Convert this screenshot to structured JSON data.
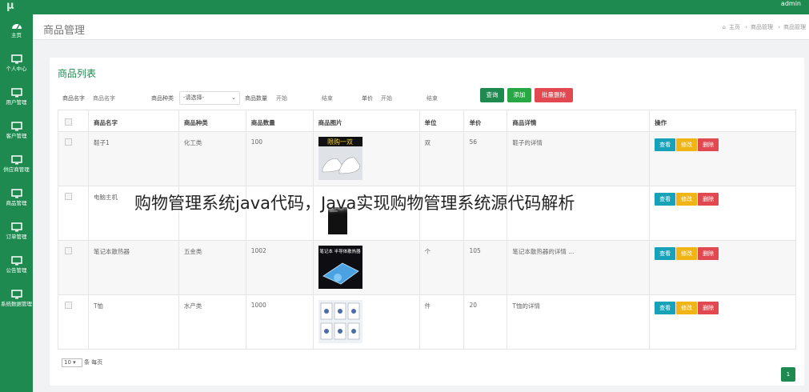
{
  "topbar": {
    "logo": "μ",
    "user": "admin"
  },
  "sidebar": {
    "items": [
      {
        "label": "主页",
        "icon": "dashboard-icon"
      },
      {
        "label": "个人中心",
        "icon": "monitor-icon"
      },
      {
        "label": "用户管理",
        "icon": "monitor-icon"
      },
      {
        "label": "客户管理",
        "icon": "monitor-icon"
      },
      {
        "label": "供应商管理",
        "icon": "monitor-icon"
      },
      {
        "label": "商品管理",
        "icon": "monitor-icon"
      },
      {
        "label": "订单管理",
        "icon": "monitor-icon"
      },
      {
        "label": "公告管理",
        "icon": "monitor-icon"
      },
      {
        "label": "系统数据管理",
        "icon": "monitor-icon"
      }
    ]
  },
  "header": {
    "title": "商品管理",
    "breadcrumb": [
      "主页",
      "商品管理",
      "商品管理"
    ]
  },
  "panel": {
    "title": "商品列表"
  },
  "search": {
    "name_label": "商品名字",
    "name_placeholder": "商品名字",
    "type_label": "商品种类",
    "type_selected": "-请选择-",
    "qty_label": "商品数量",
    "qty_start_placeholder": "开始",
    "qty_end_placeholder": "结束",
    "price_label": "单价",
    "price_start_placeholder": "开始",
    "price_end_placeholder": "结束",
    "query_button": "查询",
    "add_button": "添加",
    "batch_delete_button": "批量删除"
  },
  "table": {
    "headers": [
      "商品名字",
      "商品种类",
      "商品数量",
      "商品图片",
      "单位",
      "单价",
      "商品详情",
      "操作"
    ],
    "rows": [
      {
        "name": "鞋子1",
        "type": "化工类",
        "qty": "100",
        "unit": "双",
        "price": "56",
        "detail": "鞋子的详情",
        "image": "shoes",
        "image_text": "限购一双"
      },
      {
        "name": "电脑主机",
        "type": "",
        "qty": "",
        "unit": "",
        "price": "",
        "detail": "",
        "image": "pc-case",
        "image_text": ""
      },
      {
        "name": "笔记本散热器",
        "type": "五金类",
        "qty": "1002",
        "unit": "个",
        "price": "105",
        "detail": "笔记本散热器的详情 ...",
        "image": "cooler",
        "image_text": "笔记本 半导体散热器"
      },
      {
        "name": "T恤",
        "type": "水产类",
        "qty": "1000",
        "unit": "件",
        "price": "20",
        "detail": "T恤的详情",
        "image": "tshirts",
        "image_text": ""
      }
    ],
    "actions": {
      "view": "查看",
      "edit": "修改",
      "delete": "删除"
    }
  },
  "pagination": {
    "page_size": "10",
    "page_size_suffix": "条 每页",
    "current_page": "1"
  },
  "watermark": "购物管理系统java代码，Java实现购物管理系统源代码解析",
  "colors": {
    "primary": "#1e8a4f",
    "view": "#17a2b8",
    "edit": "#f0b414",
    "delete": "#e2484f"
  }
}
